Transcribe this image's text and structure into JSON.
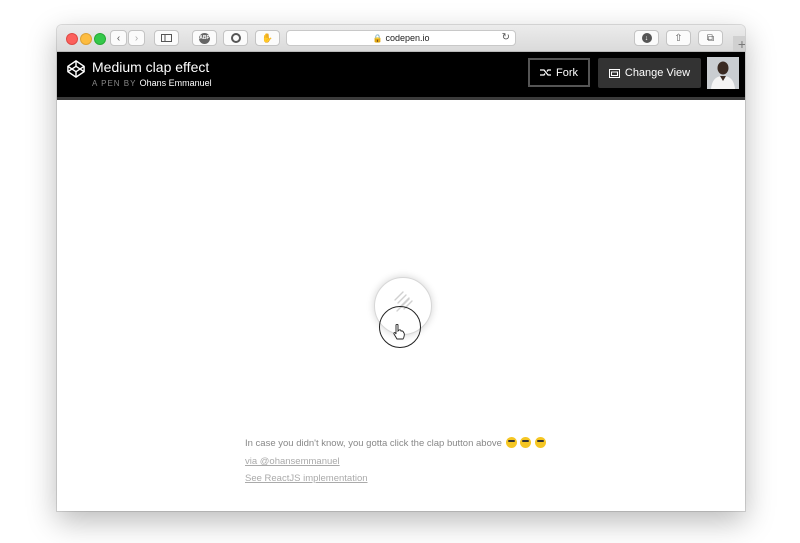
{
  "browser": {
    "url": "codepen.io",
    "adblock_label": "ABP"
  },
  "pen": {
    "title": "Medium clap effect",
    "author_prefix": "A PEN BY",
    "author_name": "Ohans Emmanuel",
    "fork_label": "Fork",
    "change_view_label": "Change View"
  },
  "content": {
    "note": "In case you didn't know, you gotta click the clap button above",
    "via_link": "via @ohansemmanuel",
    "react_link": "See ReactJS implementation"
  },
  "colors": {
    "header_bg": "#000000",
    "change_view_bg": "#333333",
    "link": "#aaaaaa"
  }
}
